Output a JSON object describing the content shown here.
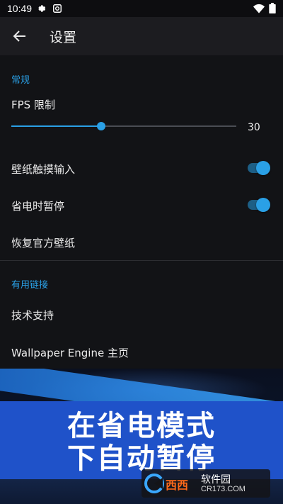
{
  "status_bar": {
    "time": "10:49",
    "left_icons": [
      "gear-icon",
      "screenshot-icon"
    ],
    "right_icons": [
      "wifi-icon",
      "battery-icon"
    ]
  },
  "app_bar": {
    "title": "设置",
    "back_icon": "arrow-left-icon"
  },
  "sections": {
    "general": {
      "header": "常规",
      "fps_label": "FPS 限制",
      "fps_value": "30",
      "fps_slider_fraction": 0.4,
      "wallpaper_touch_label": "壁纸触摸输入",
      "wallpaper_touch_on": true,
      "battery_pause_label": "省电时暂停",
      "battery_pause_on": true,
      "restore_label": "恢复官方壁纸"
    },
    "links": {
      "header": "有用链接",
      "support_label": "技术支持",
      "homepage_label": "Wallpaper Engine 主页"
    }
  },
  "promo": {
    "line1": "在省电模式",
    "line2": "下自动暂停"
  },
  "watermark": {
    "brand": "西西",
    "site_name": "软件园",
    "site_url": "CR173.COM"
  },
  "colors": {
    "accent": "#2aa0e6",
    "promo_band": "#1f52c9"
  }
}
